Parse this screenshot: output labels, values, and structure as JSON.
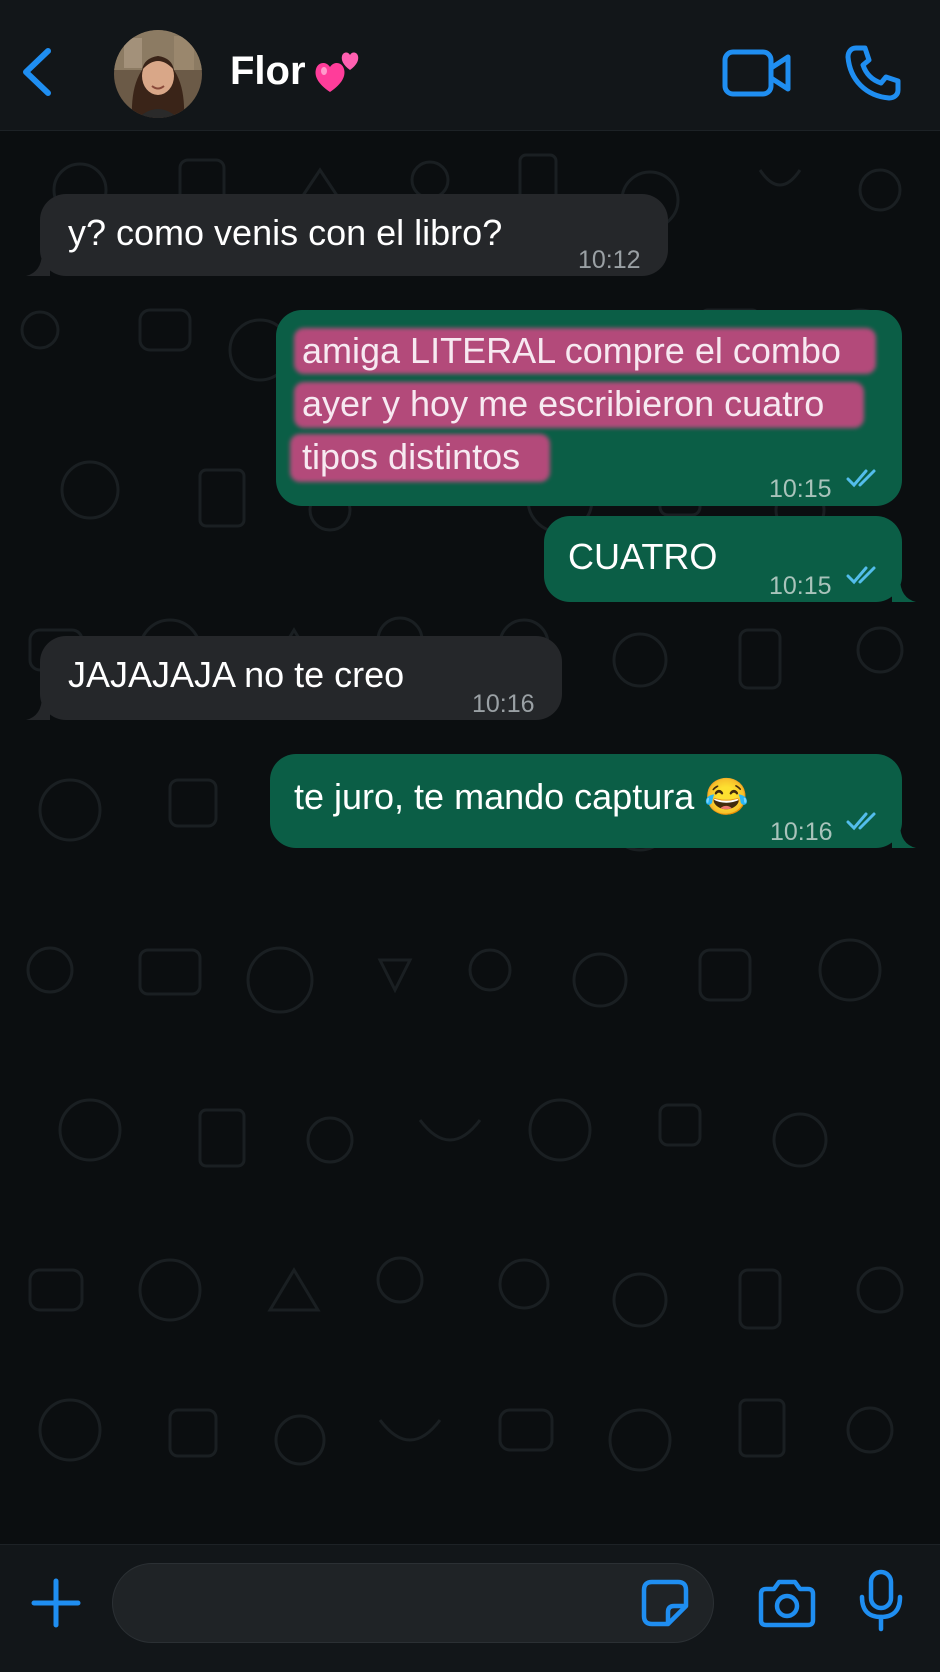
{
  "header": {
    "contact_name": "Flor",
    "contact_emoji": "💕",
    "icons": {
      "back": "chevron-left-icon",
      "video": "video-camera-icon",
      "call": "phone-icon"
    }
  },
  "messages": [
    {
      "direction": "incoming",
      "lines": [
        "y? como venis con el libro?"
      ],
      "time": "10:12"
    },
    {
      "direction": "outgoing",
      "lines": [
        "amiga LITERAL compre el combo",
        "ayer y hoy me escribieron cuatro",
        "tipos distintos"
      ],
      "time": "10:15",
      "status": "read",
      "highlighted": true
    },
    {
      "direction": "outgoing",
      "lines": [
        "CUATRO"
      ],
      "time": "10:15",
      "status": "read"
    },
    {
      "direction": "incoming",
      "lines": [
        "JAJAJAJA no te creo"
      ],
      "time": "10:16"
    },
    {
      "direction": "outgoing",
      "lines": [
        "te juro, te mando captura 😂"
      ],
      "time": "10:16",
      "status": "read"
    }
  ],
  "input_bar": {
    "message_value": "",
    "icons": {
      "plus": "plus-icon",
      "sticker": "sticker-icon",
      "camera": "camera-icon",
      "mic": "microphone-icon"
    }
  },
  "colors": {
    "accent": "#1f8ef1",
    "incoming_bubble": "#25272a",
    "outgoing_bubble": "#0b5e46",
    "highlight": "#c2497f",
    "read_ticks": "#53bdeb",
    "background": "#0b0e10"
  }
}
